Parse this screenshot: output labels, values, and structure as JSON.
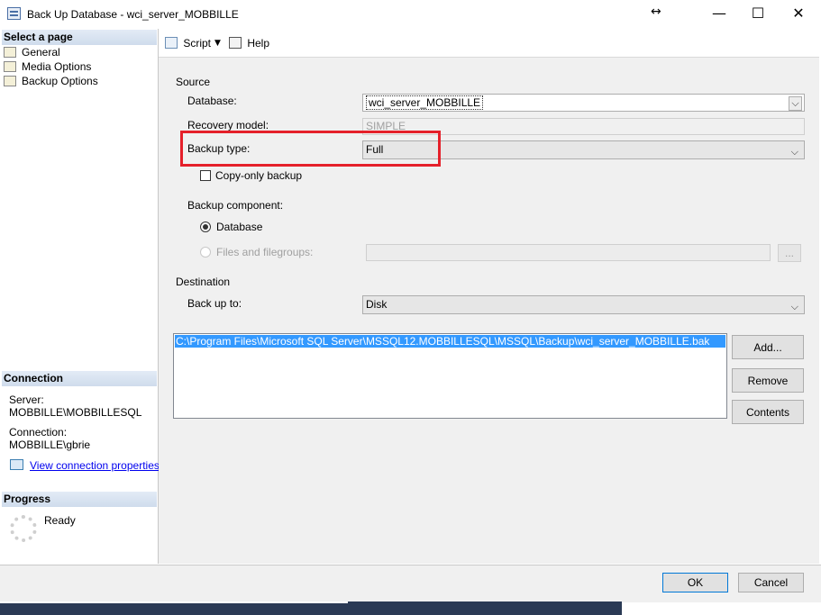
{
  "window": {
    "title": "Back Up Database - wci_server_MOBBILLE",
    "resize_glyph": "↔",
    "minimize_glyph": "—",
    "maximize_glyph": "☐",
    "close_glyph": "✕"
  },
  "sidebar": {
    "select_page_header": "Select a page",
    "pages": [
      {
        "label": "General",
        "icon": "page-wrench-icon"
      },
      {
        "label": "Media Options",
        "icon": "page-wrench-icon"
      },
      {
        "label": "Backup Options",
        "icon": "page-wrench-icon"
      }
    ],
    "connection": {
      "header": "Connection",
      "server_label": "Server:",
      "server_value": "MOBBILLE\\MOBBILLESQL",
      "connection_label": "Connection:",
      "connection_value": "MOBBILLE\\gbrie",
      "view_link": "View connection properties"
    },
    "progress": {
      "header": "Progress",
      "status": "Ready"
    }
  },
  "toolbar": {
    "script_label": "Script",
    "help_label": "Help"
  },
  "source": {
    "group_label": "Source",
    "database_label": "Database:",
    "database_value": "wci_server_MOBBILLE",
    "recovery_label": "Recovery model:",
    "recovery_value": "SIMPLE",
    "backup_type_label": "Backup type:",
    "backup_type_value": "Full",
    "copy_only_label": "Copy-only backup",
    "component_label": "Backup component:",
    "component_database": "Database",
    "component_files": "Files and filegroups:",
    "files_browse": "..."
  },
  "destination": {
    "group_label": "Destination",
    "backup_to_label": "Back up to:",
    "backup_to_value": "Disk",
    "paths": [
      "C:\\Program Files\\Microsoft SQL Server\\MSSQL12.MOBBILLESQL\\MSSQL\\Backup\\wci_server_MOBBILLE.bak"
    ],
    "add_button": "Add...",
    "remove_button": "Remove",
    "contents_button": "Contents"
  },
  "footer": {
    "ok": "OK",
    "cancel": "Cancel"
  },
  "colors": {
    "highlight_box": "#e5202a",
    "selection": "#3399ff",
    "section_header": "#d6e2f0",
    "ok_border": "#0078d7"
  }
}
